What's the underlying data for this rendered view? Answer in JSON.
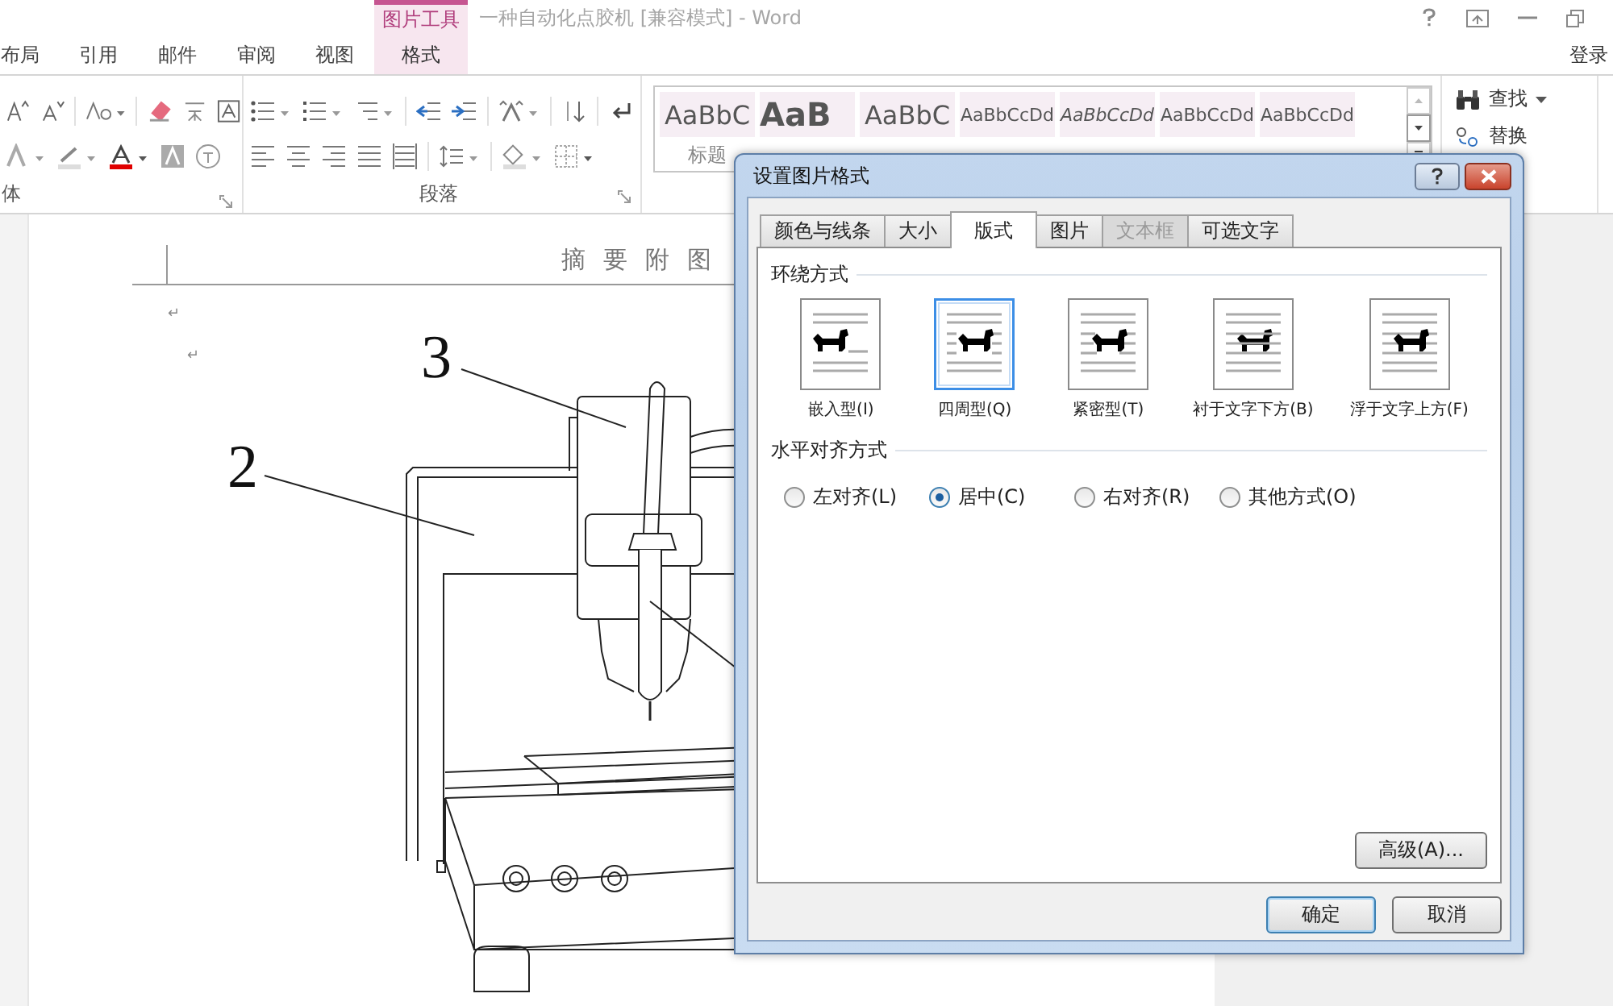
{
  "title_bar": {
    "title": "一种自动化点胶机 [兼容模式] - Word"
  },
  "ribbon_tabs": [
    {
      "label": "布局",
      "selected": false
    },
    {
      "label": "引用",
      "selected": false
    },
    {
      "label": "邮件",
      "selected": false
    },
    {
      "label": "审阅",
      "selected": false
    },
    {
      "label": "视图",
      "selected": false
    }
  ],
  "contextual_tabs": {
    "header": "图片工具",
    "tabs": [
      {
        "label": "格式",
        "selected": true
      }
    ]
  },
  "account": "登录",
  "ribbon_groups": [
    {
      "label": "体"
    },
    {
      "label": "段落"
    }
  ],
  "styles": [
    {
      "sample": "AaBbC",
      "kind": "title",
      "label": "标题"
    },
    {
      "sample": "AaB",
      "kind": "heading"
    },
    {
      "sample": "AaBbC",
      "kind": "subtitle"
    },
    {
      "sample": "AaBbCcDd",
      "kind": "normal"
    },
    {
      "sample": "AaBbCcDd",
      "kind": "emphasis"
    },
    {
      "sample": "AaBbCcDd",
      "kind": "normal"
    },
    {
      "sample": "AaBbCcDd",
      "kind": "normal"
    }
  ],
  "editing": [
    {
      "kind": "find",
      "label": "查找"
    },
    {
      "kind": "replace",
      "label": "替换"
    }
  ],
  "document": {
    "header": "摘要附图",
    "paragraph_marks": [
      "↵",
      "↵"
    ],
    "callouts": [
      "3",
      "2"
    ]
  },
  "dialog": {
    "title": "设置图片格式",
    "tabs": [
      {
        "label": "颜色与线条",
        "selected": false,
        "disabled": false
      },
      {
        "label": "大小",
        "selected": false,
        "disabled": false
      },
      {
        "label": "版式",
        "selected": true,
        "disabled": false
      },
      {
        "label": "图片",
        "selected": false,
        "disabled": false
      },
      {
        "label": "文本框",
        "selected": false,
        "disabled": true
      },
      {
        "label": "可选文字",
        "selected": false,
        "disabled": false
      }
    ],
    "wrap_section": "环绕方式",
    "wrap_options": [
      {
        "kind": "inline",
        "label": "嵌入型(I)",
        "selected": false
      },
      {
        "kind": "square",
        "label": "四周型(Q)",
        "selected": true
      },
      {
        "kind": "tight",
        "label": "紧密型(T)",
        "selected": false
      },
      {
        "kind": "behind",
        "label": "衬于文字下方(B)",
        "selected": false
      },
      {
        "kind": "front",
        "label": "浮于文字上方(F)",
        "selected": false
      }
    ],
    "align_section": "水平对齐方式",
    "align_options": [
      {
        "label": "左对齐(L)",
        "selected": false
      },
      {
        "label": "居中(C)",
        "selected": true
      },
      {
        "label": "右对齐(R)",
        "selected": false
      },
      {
        "label": "其他方式(O)",
        "selected": false
      }
    ],
    "advanced_button": "高级(A)...",
    "buttons": [
      {
        "label": "确定",
        "default": true
      },
      {
        "label": "取消",
        "default": false
      }
    ]
  }
}
